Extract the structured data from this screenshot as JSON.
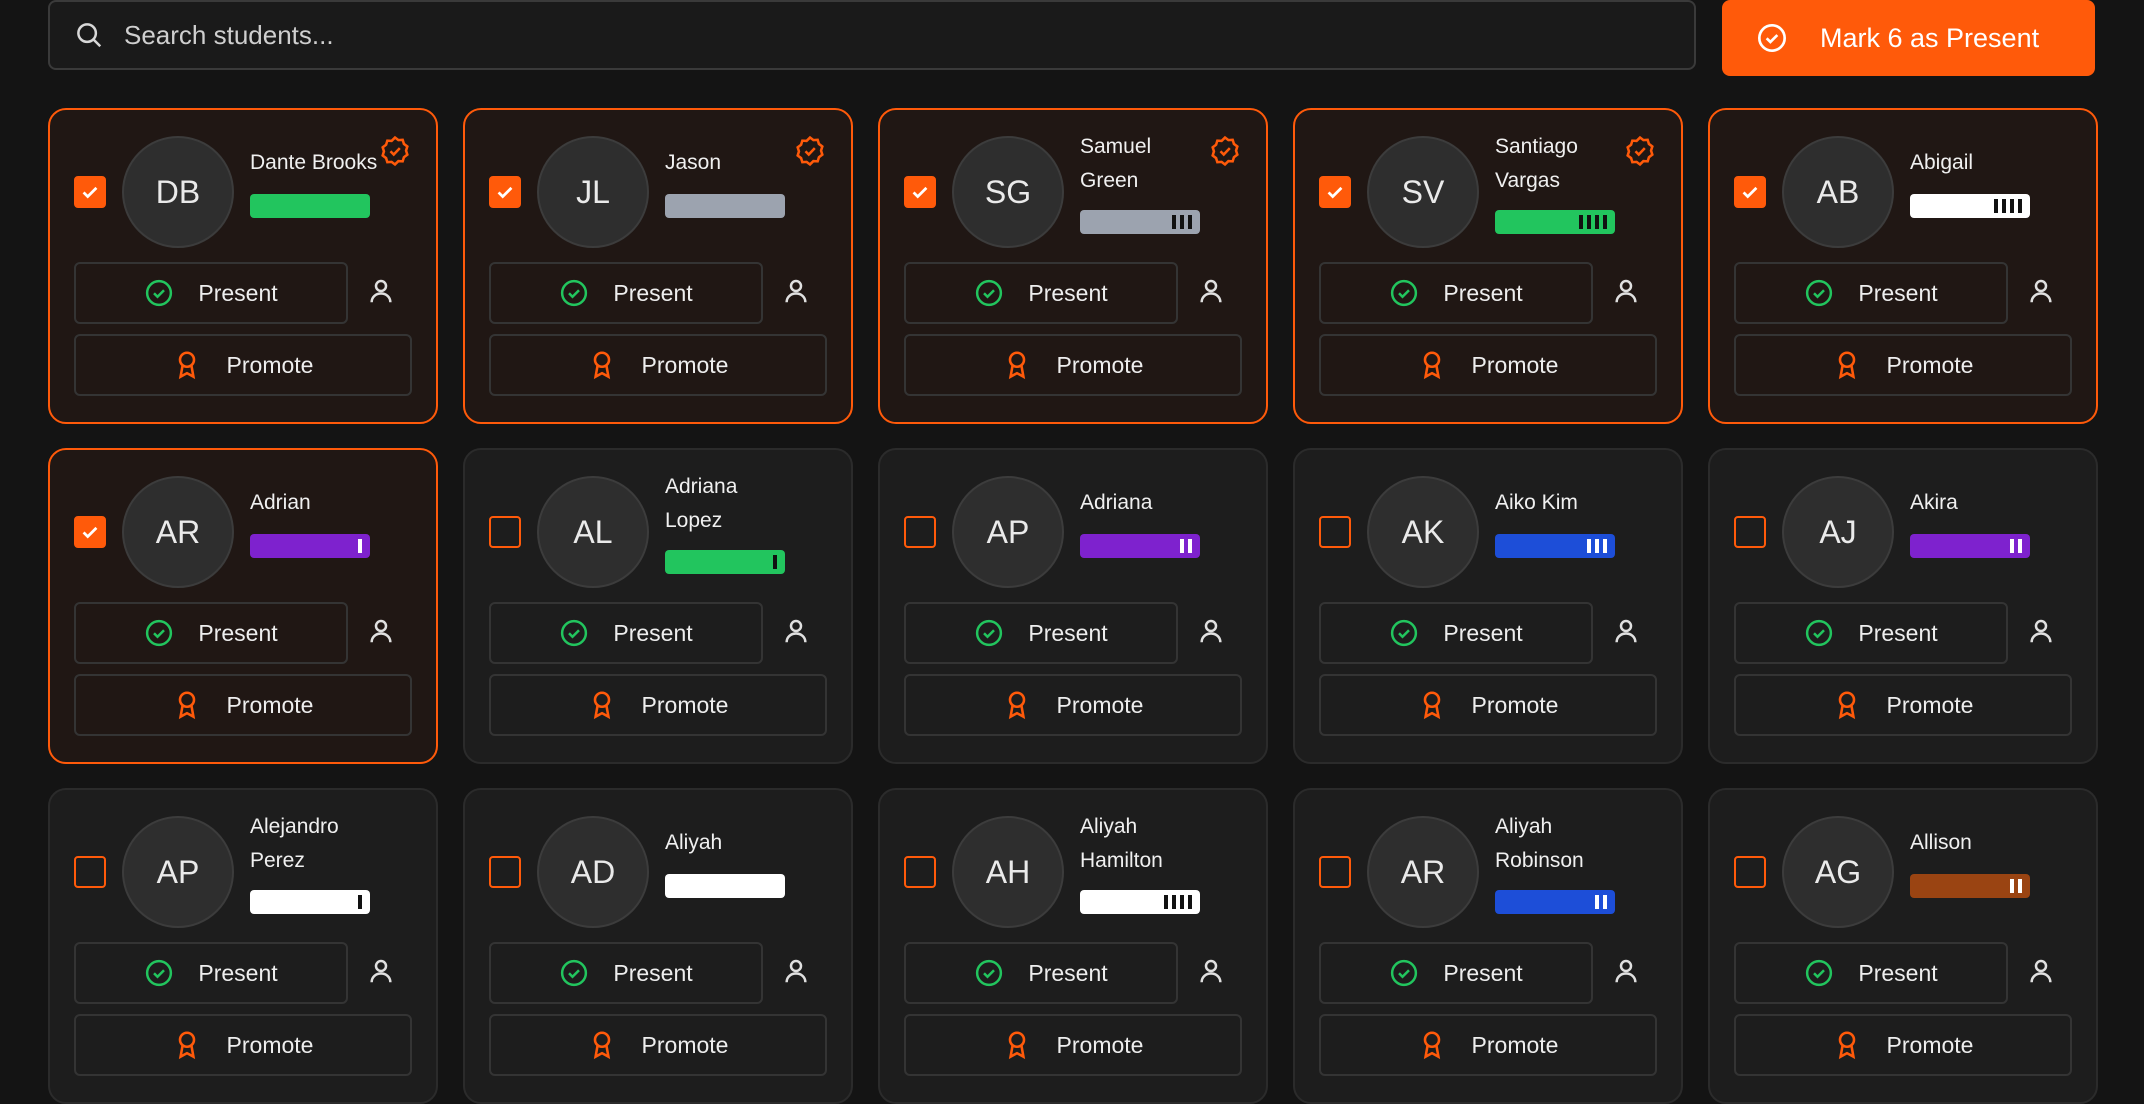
{
  "search": {
    "placeholder": "Search students..."
  },
  "mark_button": {
    "label": "Mark 6 as Present"
  },
  "card_actions": {
    "present_label": "Present",
    "promote_label": "Promote"
  },
  "colors": {
    "accent": "#ff5a0a",
    "present_green": "#22c55e"
  },
  "students": [
    {
      "initials": "DB",
      "name": "Dante Brooks",
      "selected": true,
      "belt_color": "#22c55e",
      "stripes": 0,
      "badge": true
    },
    {
      "initials": "JL",
      "name": "Jason",
      "selected": true,
      "belt_color": "#9ca3af",
      "stripes": 0,
      "badge": true
    },
    {
      "initials": "SG",
      "name": "Samuel Green",
      "selected": true,
      "belt_color": "#9ca3af",
      "stripes": 3,
      "badge": true
    },
    {
      "initials": "SV",
      "name": "Santiago Vargas",
      "selected": true,
      "belt_color": "#22c55e",
      "stripes": 4,
      "badge": true
    },
    {
      "initials": "AB",
      "name": "Abigail",
      "selected": true,
      "belt_color": "#ffffff",
      "stripes": 4,
      "badge": false
    },
    {
      "initials": "AR",
      "name": "Adrian",
      "selected": true,
      "belt_color": "#7e22ce",
      "stripes": 1,
      "badge": false
    },
    {
      "initials": "AL",
      "name": "Adriana Lopez",
      "selected": false,
      "belt_color": "#22c55e",
      "stripes": 1,
      "badge": false
    },
    {
      "initials": "AP",
      "name": "Adriana",
      "selected": false,
      "belt_color": "#7e22ce",
      "stripes": 2,
      "badge": false
    },
    {
      "initials": "AK",
      "name": "Aiko Kim",
      "selected": false,
      "belt_color": "#1d4ed8",
      "stripes": 3,
      "badge": false
    },
    {
      "initials": "AJ",
      "name": "Akira",
      "selected": false,
      "belt_color": "#7e22ce",
      "stripes": 2,
      "badge": false
    },
    {
      "initials": "AP",
      "name": "Alejandro Perez",
      "selected": false,
      "belt_color": "#ffffff",
      "stripes": 1,
      "badge": false
    },
    {
      "initials": "AD",
      "name": "Aliyah",
      "selected": false,
      "belt_color": "#ffffff",
      "stripes": 0,
      "badge": false
    },
    {
      "initials": "AH",
      "name": "Aliyah Hamilton",
      "selected": false,
      "belt_color": "#ffffff",
      "stripes": 4,
      "badge": false
    },
    {
      "initials": "AR",
      "name": "Aliyah Robinson",
      "selected": false,
      "belt_color": "#1d4ed8",
      "stripes": 2,
      "badge": false
    },
    {
      "initials": "AG",
      "name": "Allison",
      "selected": false,
      "belt_color": "#9a4412",
      "stripes": 2,
      "badge": false
    }
  ]
}
